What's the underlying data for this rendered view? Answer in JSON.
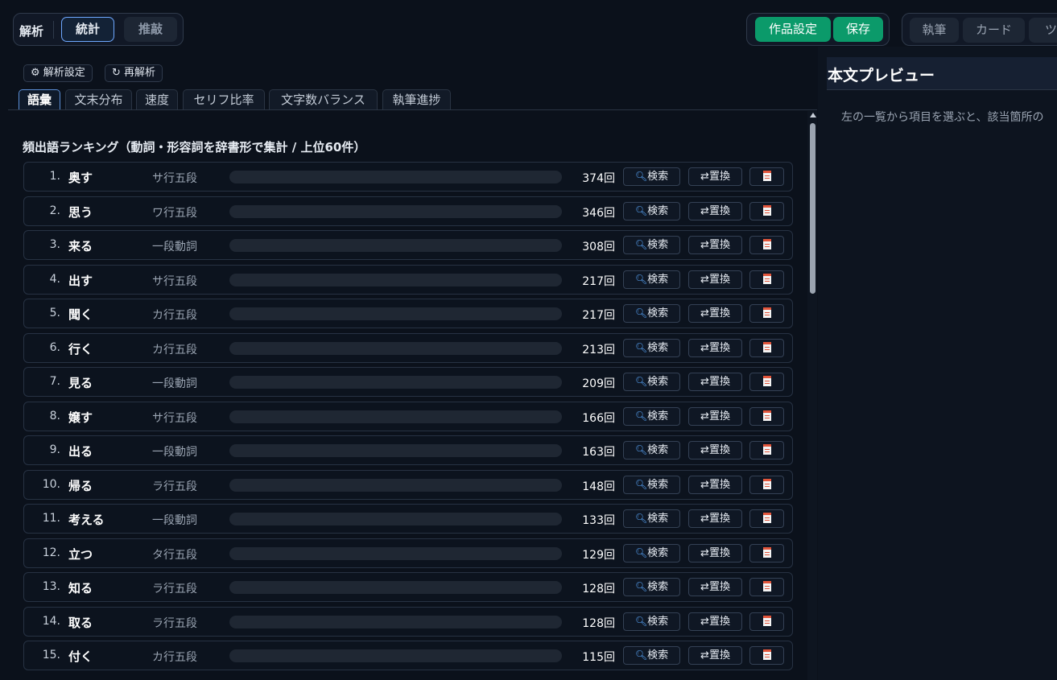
{
  "header": {
    "mode_label": "解析",
    "mode_tabs": [
      {
        "label": "統計",
        "active": true
      },
      {
        "label": "推敲",
        "active": false
      }
    ],
    "work_settings_label": "作品設定",
    "save_label": "保存",
    "nav_tabs": [
      "執筆",
      "カード",
      "ツー"
    ]
  },
  "toolbar": {
    "analysis_settings_label": "⚙ 解析設定",
    "reanalyze_label": "↻ 再解析"
  },
  "tabs": [
    "語彙",
    "文末分布",
    "速度",
    "セリフ比率",
    "文字数バランス",
    "執筆進捗"
  ],
  "active_tab": "語彙",
  "ranking": {
    "heading": "頻出語ランキング（動詞・形容詞を辞書形で集計 / 上位60件）",
    "unit": "回",
    "search_label": "検索",
    "replace_label": "⇄置換",
    "items": [
      {
        "rank": "1.",
        "word": "奥す",
        "pos": "サ行五段",
        "count": 374
      },
      {
        "rank": "2.",
        "word": "思う",
        "pos": "ワ行五段",
        "count": 346
      },
      {
        "rank": "3.",
        "word": "来る",
        "pos": "一段動詞",
        "count": 308
      },
      {
        "rank": "4.",
        "word": "出す",
        "pos": "サ行五段",
        "count": 217
      },
      {
        "rank": "5.",
        "word": "聞く",
        "pos": "カ行五段",
        "count": 217
      },
      {
        "rank": "6.",
        "word": "行く",
        "pos": "カ行五段",
        "count": 213
      },
      {
        "rank": "7.",
        "word": "見る",
        "pos": "一段動詞",
        "count": 209
      },
      {
        "rank": "8.",
        "word": "嬢す",
        "pos": "サ行五段",
        "count": 166
      },
      {
        "rank": "9.",
        "word": "出る",
        "pos": "一段動詞",
        "count": 163
      },
      {
        "rank": "10.",
        "word": "帰る",
        "pos": "ラ行五段",
        "count": 148
      },
      {
        "rank": "11.",
        "word": "考える",
        "pos": "一段動詞",
        "count": 133
      },
      {
        "rank": "12.",
        "word": "立つ",
        "pos": "タ行五段",
        "count": 129
      },
      {
        "rank": "13.",
        "word": "知る",
        "pos": "ラ行五段",
        "count": 128
      },
      {
        "rank": "14.",
        "word": "取る",
        "pos": "ラ行五段",
        "count": 128
      },
      {
        "rank": "15.",
        "word": "付く",
        "pos": "カ行五段",
        "count": 115
      }
    ]
  },
  "preview": {
    "title": "本文プレビュー",
    "hint": "左の一覧から項目を選ぶと、該当箇所の"
  },
  "colors": {
    "accent_green": "#0b9a6a",
    "active_outline": "#6ea8ff",
    "background": "#0b111b"
  }
}
